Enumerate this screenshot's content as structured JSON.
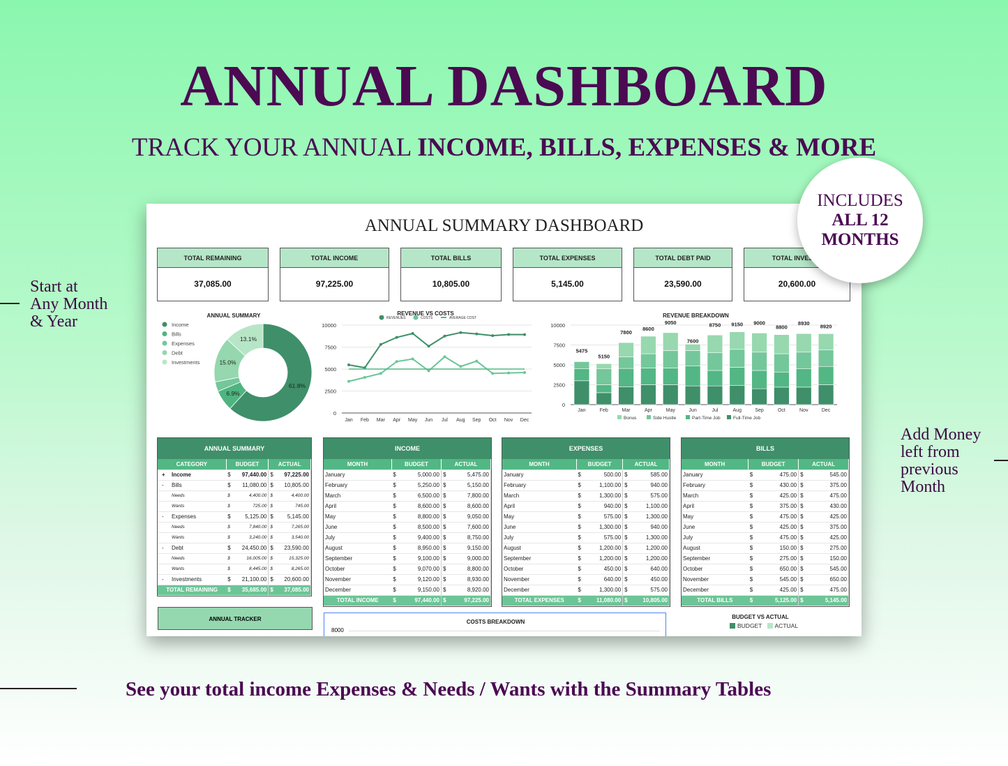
{
  "header": {
    "title": "ANNUAL DASHBOARD",
    "subtitle_plain": "TRACK YOUR ANNUAL ",
    "subtitle_bold": "INCOME, BILLS, EXPENSES & MORE"
  },
  "badge": {
    "line1": "INCLUDES",
    "line2": "ALL 12",
    "line3": "MONTHS"
  },
  "side_left": [
    "Start at",
    "Any Month",
    "& Year"
  ],
  "side_right": [
    "Add Money",
    "left from",
    "previous",
    "Month"
  ],
  "bottom_caption": "See your total income Expenses & Needs / Wants with the Summary Tables",
  "dashboard": {
    "title": "ANNUAL SUMMARY DASHBOARD",
    "kpis": [
      {
        "label": "TOTAL REMAINING",
        "value": "37,085.00"
      },
      {
        "label": "TOTAL INCOME",
        "value": "97,225.00"
      },
      {
        "label": "TOTAL BILLS",
        "value": "10,805.00"
      },
      {
        "label": "TOTAL EXPENSES",
        "value": "5,145.00"
      },
      {
        "label": "TOTAL DEBT PAID",
        "value": "23,590.00"
      },
      {
        "label": "TOTAL INVESTM",
        "value": "20,600.00"
      }
    ],
    "annual_tracker": "ANNUAL TRACKER",
    "costs_breakdown": {
      "title": "COSTS BREAKDOWN",
      "tick": "8000"
    },
    "budget_vs_actual": {
      "title": "BUDGET VS ACTUAL",
      "legend": [
        "BUDGET",
        "ACTUAL"
      ]
    },
    "tables": {
      "summary": {
        "title": "ANNUAL SUMMARY",
        "headers": [
          "CATEGORY",
          "BUDGET",
          "ACTUAL"
        ],
        "rows": [
          {
            "mark": "+",
            "label": "Income",
            "budget": "97,440.00",
            "actual": "97,225.00",
            "bold": true
          },
          {
            "mark": "-",
            "label": "Bills",
            "budget": "11,080.00",
            "actual": "10,805.00"
          },
          {
            "mark": "",
            "label": "Needs",
            "budget": "4,400.00",
            "actual": "4,400.00",
            "sub": true
          },
          {
            "mark": "",
            "label": "Wants",
            "budget": "725.00",
            "actual": "745.00",
            "sub": true
          },
          {
            "mark": "-",
            "label": "Expenses",
            "budget": "5,125.00",
            "actual": "5,145.00"
          },
          {
            "mark": "",
            "label": "Needs",
            "budget": "7,840.00",
            "actual": "7,265.00",
            "sub": true
          },
          {
            "mark": "",
            "label": "Wants",
            "budget": "3,240.00",
            "actual": "3,540.00",
            "sub": true
          },
          {
            "mark": "-",
            "label": "Debt",
            "budget": "24,450.00",
            "actual": "23,590.00"
          },
          {
            "mark": "",
            "label": "Needs",
            "budget": "16,005.00",
            "actual": "15,325.00",
            "sub": true
          },
          {
            "mark": "",
            "label": "Wants",
            "budget": "8,445.00",
            "actual": "8,265.00",
            "sub": true
          },
          {
            "mark": "-",
            "label": "Investments",
            "budget": "21,100.00",
            "actual": "20,600.00"
          }
        ],
        "total": {
          "label": "TOTAL REMAINING",
          "budget": "35,685.00",
          "actual": "37,085.00"
        }
      },
      "income": {
        "title": "INCOME",
        "headers": [
          "MONTH",
          "BUDGET",
          "ACTUAL"
        ],
        "rows": [
          [
            "January",
            "5,000.00",
            "5,475.00"
          ],
          [
            "February",
            "5,250.00",
            "5,150.00"
          ],
          [
            "March",
            "6,500.00",
            "7,800.00"
          ],
          [
            "April",
            "8,600.00",
            "8,600.00"
          ],
          [
            "May",
            "8,800.00",
            "9,050.00"
          ],
          [
            "June",
            "8,500.00",
            "7,600.00"
          ],
          [
            "July",
            "9,400.00",
            "8,750.00"
          ],
          [
            "August",
            "8,950.00",
            "9,150.00"
          ],
          [
            "September",
            "9,100.00",
            "9,000.00"
          ],
          [
            "October",
            "9,070.00",
            "8,800.00"
          ],
          [
            "November",
            "9,120.00",
            "8,930.00"
          ],
          [
            "December",
            "9,150.00",
            "8,920.00"
          ]
        ],
        "total": {
          "label": "TOTAL INCOME",
          "budget": "97,440.00",
          "actual": "97,225.00"
        }
      },
      "expenses": {
        "title": "EXPENSES",
        "headers": [
          "MONTH",
          "BUDGET",
          "ACTUAL"
        ],
        "rows": [
          [
            "January",
            "500.00",
            "585.00"
          ],
          [
            "February",
            "1,100.00",
            "940.00"
          ],
          [
            "March",
            "1,300.00",
            "575.00"
          ],
          [
            "April",
            "940.00",
            "1,100.00"
          ],
          [
            "May",
            "575.00",
            "1,300.00"
          ],
          [
            "June",
            "1,300.00",
            "940.00"
          ],
          [
            "July",
            "575.00",
            "1,300.00"
          ],
          [
            "August",
            "1,200.00",
            "1,200.00"
          ],
          [
            "September",
            "1,200.00",
            "1,200.00"
          ],
          [
            "October",
            "450.00",
            "640.00"
          ],
          [
            "November",
            "640.00",
            "450.00"
          ],
          [
            "December",
            "1,300.00",
            "575.00"
          ]
        ],
        "total": {
          "label": "TOTAL EXPENSES",
          "budget": "11,080.00",
          "actual": "10,805.00"
        }
      },
      "bills": {
        "title": "BILLS",
        "headers": [
          "MONTH",
          "BUDGET",
          "ACTUAL"
        ],
        "rows": [
          [
            "January",
            "475.00",
            "545.00"
          ],
          [
            "February",
            "430.00",
            "375.00"
          ],
          [
            "March",
            "425.00",
            "475.00"
          ],
          [
            "April",
            "375.00",
            "430.00"
          ],
          [
            "May",
            "475.00",
            "425.00"
          ],
          [
            "June",
            "425.00",
            "375.00"
          ],
          [
            "July",
            "475.00",
            "425.00"
          ],
          [
            "August",
            "150.00",
            "275.00"
          ],
          [
            "September",
            "275.00",
            "150.00"
          ],
          [
            "October",
            "650.00",
            "545.00"
          ],
          [
            "November",
            "545.00",
            "650.00"
          ],
          [
            "December",
            "425.00",
            "475.00"
          ]
        ],
        "total": {
          "label": "TOTAL BILLS",
          "budget": "5,125.00",
          "actual": "5,145.00"
        }
      }
    },
    "currency": "$"
  },
  "chart_data": [
    {
      "type": "pie",
      "title": "ANNUAL SUMMARY",
      "legend": "left",
      "categories": [
        "Income",
        "Bills",
        "Expenses",
        "Debt",
        "Investments"
      ],
      "values": [
        61.8,
        6.9,
        3.2,
        15.0,
        13.1
      ],
      "labels": [
        "61.8%",
        "6.9%",
        "",
        "15.0%",
        "13.1%"
      ],
      "colors": [
        "#3f8f6a",
        "#4fb47f",
        "#73c79a",
        "#95d7ae",
        "#b7e6c7"
      ]
    },
    {
      "type": "line",
      "title": "REVENUE VS COSTS",
      "legend": "top",
      "categories": [
        "Jan",
        "Feb",
        "Mar",
        "Apr",
        "May",
        "Jun",
        "Jul",
        "Aug",
        "Sep",
        "Oct",
        "Nov",
        "Dec"
      ],
      "ylim": [
        0,
        10000
      ],
      "yticks": [
        0,
        2500,
        5000,
        7500,
        10000
      ],
      "grid": true,
      "series": [
        {
          "name": "REVENUES",
          "values": [
            5475,
            5150,
            7800,
            8600,
            9050,
            7600,
            8750,
            9150,
            9000,
            8800,
            8930,
            8920
          ],
          "color": "#3f8f6a"
        },
        {
          "name": "COSTS",
          "values": [
            3600,
            4050,
            4500,
            5850,
            6150,
            4800,
            6400,
            5300,
            5900,
            4500,
            4550,
            4600
          ],
          "color": "#6cc597"
        },
        {
          "name": "AVERAGE COST",
          "values": [
            5000,
            5000,
            5000,
            5000,
            5000,
            5000,
            5000,
            5000,
            5000,
            5000,
            5000,
            5000
          ],
          "color": "#52b784"
        }
      ]
    },
    {
      "type": "bar",
      "stacked": true,
      "title": "REVENUE BREAKDOWN",
      "legend": "bottom",
      "categories": [
        "Jan",
        "Feb",
        "Mar",
        "Apr",
        "May",
        "Jun",
        "Jul",
        "Aug",
        "Sep",
        "Oct",
        "Nov",
        "Dec"
      ],
      "ylim": [
        0,
        10000
      ],
      "yticks": [
        0,
        2500,
        5000,
        7500,
        10000
      ],
      "grid": true,
      "totals": [
        5475,
        5150,
        7800,
        8600,
        9050,
        7600,
        8750,
        9150,
        9000,
        8800,
        8930,
        8920
      ],
      "series": [
        {
          "name": "Full-Time Job",
          "values": [
            3000,
            1500,
            2250,
            2500,
            2500,
            2350,
            2350,
            2400,
            2000,
            2200,
            2200,
            2500
          ],
          "color": "#3f8f6a"
        },
        {
          "name": "Part-Time Job",
          "values": [
            1500,
            1000,
            2300,
            2100,
            2100,
            2500,
            1950,
            2300,
            2300,
            1900,
            2300,
            2300
          ],
          "color": "#52b784"
        },
        {
          "name": "Side Hustle",
          "values": [
            900,
            2000,
            1450,
            1800,
            2200,
            1950,
            2250,
            2250,
            2300,
            2300,
            2100,
            2100
          ],
          "color": "#74c79b"
        },
        {
          "name": "Bonus",
          "values": [
            75,
            650,
            1800,
            2200,
            2250,
            800,
            2200,
            2200,
            2400,
            2400,
            2330,
            2020
          ],
          "color": "#97d8af"
        }
      ]
    }
  ]
}
